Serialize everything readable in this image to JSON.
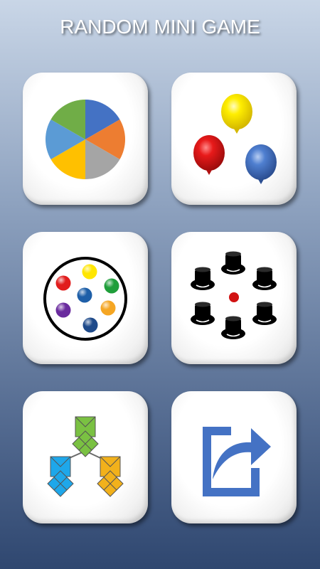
{
  "header": {
    "title": "RANDOM MINI GAME"
  },
  "games": [
    {
      "icon": "spin-wheel-icon"
    },
    {
      "icon": "balloons-icon"
    },
    {
      "icon": "marbles-circle-icon"
    },
    {
      "icon": "hats-cups-icon"
    },
    {
      "icon": "folded-paper-tree-icon"
    },
    {
      "icon": "share-icon"
    }
  ],
  "colors": {
    "wheel": [
      "#4472c4",
      "#ed7d31",
      "#a5a5a5",
      "#ffc000",
      "#5b9bd5",
      "#70ad47"
    ],
    "balloons": [
      "#ffea00",
      "#e11d1d",
      "#4472c4"
    ],
    "marbles": [
      "#e11d1d",
      "#ffe600",
      "#1f9e3a",
      "#1e5fa8",
      "#f5a623",
      "#6a2b9e",
      "#1e4a8a"
    ],
    "tree": [
      "#7ac142",
      "#1ea7ea",
      "#f2b11b"
    ],
    "share": "#4472c4"
  }
}
